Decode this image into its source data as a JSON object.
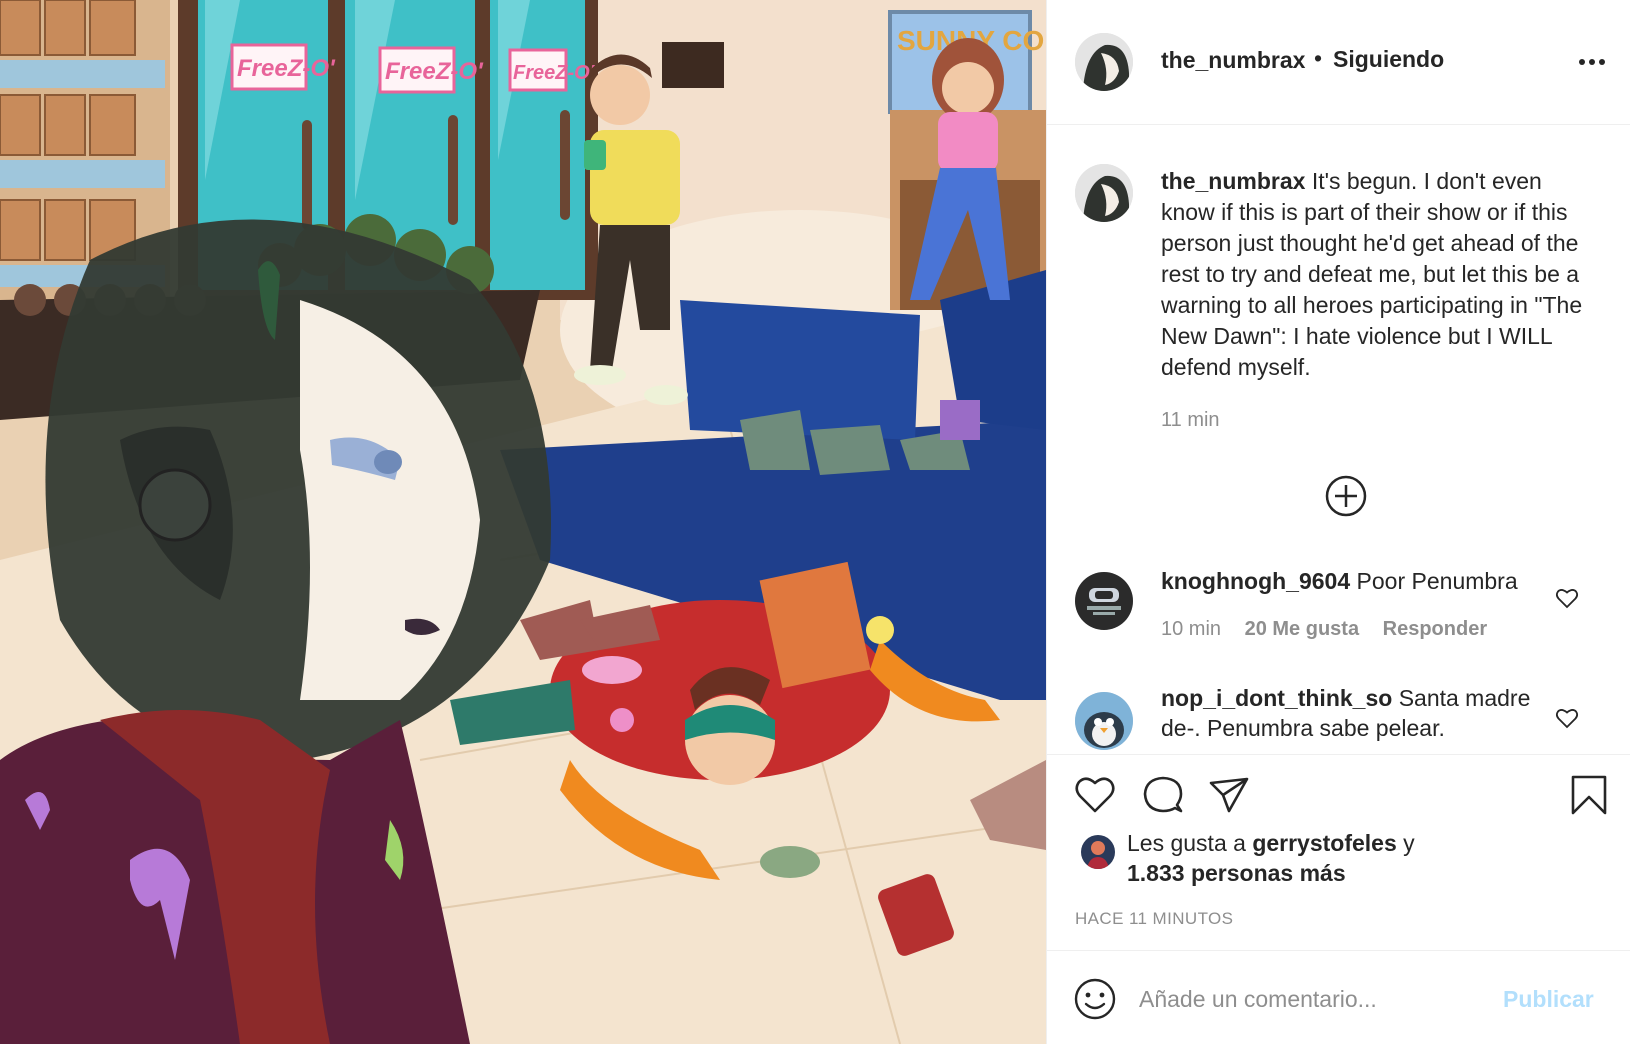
{
  "post": {
    "artwork_icon": "cartoon-illustration",
    "store_signs": [
      "FreeZ-O'",
      "FreeZ-O'",
      "FreeZ-O'"
    ],
    "corner_sign": "SUNNY CO"
  },
  "header": {
    "username": "the_numbrax",
    "separator": "•",
    "follow_status": "Siguiendo"
  },
  "caption": {
    "username": "the_numbrax",
    "text": "It's begun. I don't even know if this is part of their show or if this person just thought he'd get ahead of the rest to try and defeat me, but let this be a warning to all heroes participating in \"The New Dawn\": I hate violence but I WILL defend myself.",
    "time": "11 min"
  },
  "comments": [
    {
      "username": "knoghnogh_9604",
      "text": "Poor Penumbra",
      "time": "10 min",
      "likes": "20 Me gusta",
      "reply": "Responder"
    },
    {
      "username": "nop_i_dont_think_so",
      "text": "Santa madre de-. Penumbra sabe pelear."
    }
  ],
  "likes": {
    "prefix": "Les gusta a",
    "user": "gerrystofeles",
    "connector": "y",
    "count": "1.833 personas más"
  },
  "timestamp": "HACE 11 MINUTOS",
  "add_comment": {
    "placeholder": "Añade un comentario...",
    "publish": "Publicar"
  },
  "colors": {
    "text": "#262626",
    "secondary": "#8e8e8e",
    "publish_disabled": "#b2dffc",
    "border": "#efefef"
  }
}
